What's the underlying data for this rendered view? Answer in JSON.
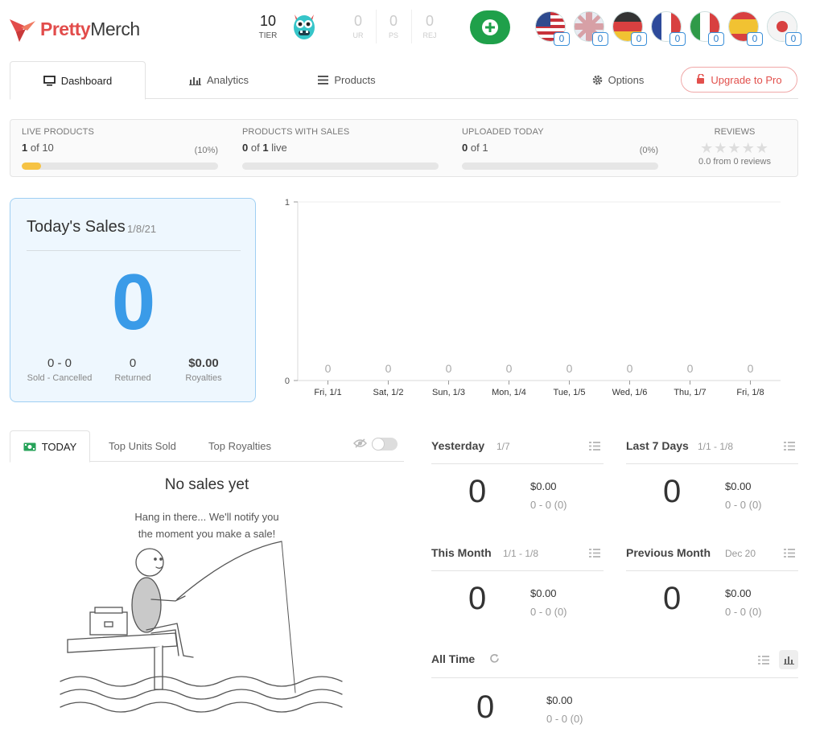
{
  "brand": {
    "name_part1": "Pretty",
    "name_part2": "Merch"
  },
  "header": {
    "tier_value": "10",
    "tier_label": "TIER",
    "stats": [
      {
        "value": "0",
        "label": "UR"
      },
      {
        "value": "0",
        "label": "PS"
      },
      {
        "value": "0",
        "label": "REJ"
      }
    ],
    "flags": [
      {
        "icon": "us-flag-icon",
        "count": "0"
      },
      {
        "icon": "uk-flag-icon",
        "count": "0"
      },
      {
        "icon": "de-flag-icon",
        "count": "0"
      },
      {
        "icon": "fr-flag-icon",
        "count": "0"
      },
      {
        "icon": "it-flag-icon",
        "count": "0"
      },
      {
        "icon": "es-flag-icon",
        "count": "0"
      },
      {
        "icon": "jp-flag-icon",
        "count": "0"
      }
    ]
  },
  "tabs": {
    "dashboard": "Dashboard",
    "analytics": "Analytics",
    "products": "Products",
    "options": "Options",
    "upgrade": "Upgrade to Pro"
  },
  "summary": {
    "live_products": {
      "title": "LIVE PRODUCTS",
      "value": "1",
      "of_text": "of 10",
      "pct": "(10%)",
      "progress": 0.1
    },
    "products_with_sales": {
      "title": "PRODUCTS WITH SALES",
      "value": "0",
      "of_text": "of",
      "of_value": "1",
      "suffix": "live",
      "progress": 0
    },
    "uploaded_today": {
      "title": "UPLOADED TODAY",
      "value": "0",
      "of_text": "of 1",
      "pct": "(0%)",
      "progress": 0
    },
    "reviews": {
      "title": "REVIEWS",
      "score": "0.0",
      "from_text": "from",
      "count": "0",
      "suffix": "reviews",
      "stars": 0
    }
  },
  "today_sales": {
    "title": "Today's Sales",
    "date": "1/8/21",
    "big_value": "0",
    "sold_cancelled": "0 - 0",
    "sold_cancelled_label": "Sold - Cancelled",
    "returned": "0",
    "returned_label": "Returned",
    "royalties": "$0.00",
    "royalties_label": "Royalties"
  },
  "chart_data": {
    "type": "bar",
    "categories": [
      "Fri, 1/1",
      "Sat, 1/2",
      "Sun, 1/3",
      "Mon, 1/4",
      "Tue, 1/5",
      "Wed, 1/6",
      "Thu, 1/7",
      "Fri, 1/8"
    ],
    "values": [
      0,
      0,
      0,
      0,
      0,
      0,
      0,
      0
    ],
    "data_labels": [
      "0",
      "0",
      "0",
      "0",
      "0",
      "0",
      "0",
      "0"
    ],
    "y_ticks": [
      "0",
      "1"
    ],
    "ylim": [
      0,
      1
    ],
    "grid": true
  },
  "sales_panel": {
    "tabs": {
      "today": "TODAY",
      "top_units": "Top Units Sold",
      "top_royalties": "Top Royalties"
    },
    "no_sales_title": "No sales yet",
    "no_sales_line1": "Hang in there... We'll notify you",
    "no_sales_line2": "the moment you make a sale!"
  },
  "stat_cards": {
    "yesterday": {
      "title": "Yesterday",
      "date": "1/7",
      "value": "0",
      "money": "$0.00",
      "sc": "0 - 0  (0)"
    },
    "last7": {
      "title": "Last 7 Days",
      "date": "1/1 - 1/8",
      "value": "0",
      "money": "$0.00",
      "sc": "0 - 0  (0)"
    },
    "this_month": {
      "title": "This Month",
      "date": "1/1 - 1/8",
      "value": "0",
      "money": "$0.00",
      "sc": "0 - 0  (0)"
    },
    "previous_month": {
      "title": "Previous Month",
      "date": "Dec 20",
      "value": "0",
      "money": "$0.00",
      "sc": "0 - 0  (0)"
    },
    "all_time": {
      "title": "All Time",
      "value": "0",
      "money": "$0.00",
      "sc": "0 - 0  (0)"
    }
  },
  "colors": {
    "brand": "#e24c4b",
    "accent_blue": "#3a9be8",
    "add_green": "#1fa04a",
    "progress_yellow": "#f6c344"
  }
}
